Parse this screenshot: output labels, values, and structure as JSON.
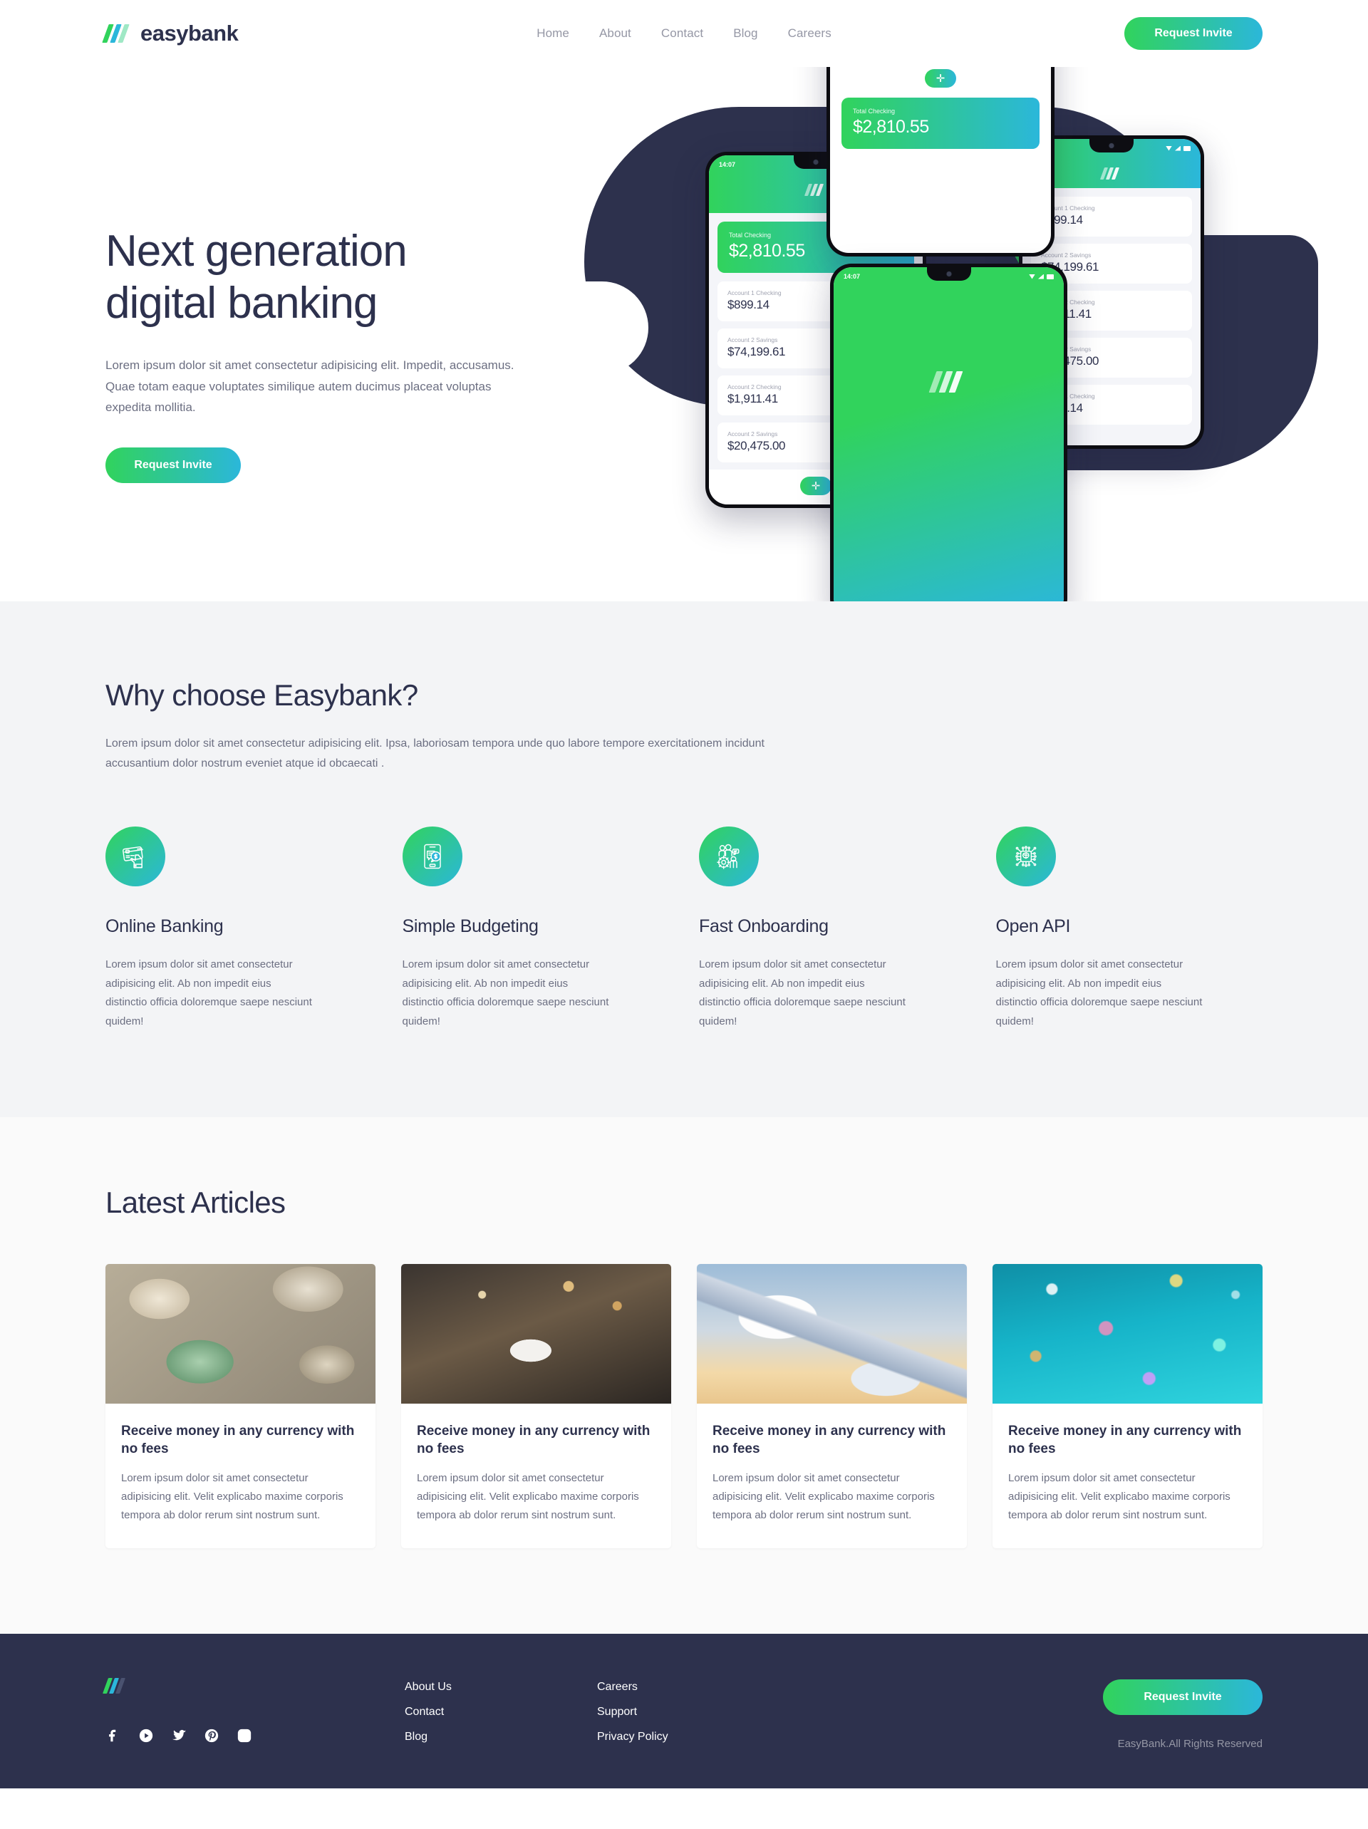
{
  "brand": {
    "name": "easybank",
    "logo_icon": "easybank-stripes-logo"
  },
  "nav": {
    "items": [
      {
        "label": "Home"
      },
      {
        "label": "About"
      },
      {
        "label": "Contact"
      },
      {
        "label": "Blog"
      },
      {
        "label": "Careers"
      }
    ],
    "cta_label": "Request Invite"
  },
  "hero": {
    "title": "Next generation\ndigital banking",
    "subtitle": "Lorem ipsum dolor sit amet consectetur adipisicing elit. Impedit, accusamus. Quae totam eaque voluptates similique autem ducimus placeat voluptas expedita mollitia.",
    "cta_label": "Request Invite",
    "phone_mock": {
      "status_time": "14:07",
      "total_label": "Total Checking",
      "total_amount": "$2,810.55",
      "accounts": [
        {
          "label": "Account 1 Checking",
          "amount": "$899.14"
        },
        {
          "label": "Account 2 Savings",
          "amount": "$74,199.61"
        },
        {
          "label": "Account 2 Checking",
          "amount": "$1,911.41"
        },
        {
          "label": "Account 2 Savings",
          "amount": "$20,475.00"
        },
        {
          "label": "Account 1 Checking",
          "amount": "$899.14"
        }
      ],
      "fab_label": "✛"
    }
  },
  "why": {
    "title": "Why choose Easybank?",
    "subtitle": "Lorem ipsum dolor sit amet consectetur adipisicing elit. Ipsa, laboriosam tempora unde quo labore tempore exercitationem incidunt accusantium dolor nostrum eveniet atque id obcaecati .",
    "features": [
      {
        "icon": "credit-card-hand-icon",
        "title": "Online Banking",
        "text": "Lorem ipsum dolor sit amet consectetur adipisicing elit. Ab non impedit eius distinctio officia doloremque saepe nesciunt quidem!"
      },
      {
        "icon": "phone-money-chat-icon",
        "title": "Simple Budgeting",
        "text": "Lorem ipsum dolor sit amet consectetur adipisicing elit. Ab non impedit eius distinctio officia doloremque saepe nesciunt quidem!"
      },
      {
        "icon": "team-onboarding-icon",
        "title": "Fast Onboarding",
        "text": "Lorem ipsum dolor sit amet consectetur adipisicing elit. Ab non impedit eius distinctio officia doloremque saepe nesciunt quidem!"
      },
      {
        "icon": "api-chip-icon",
        "title": "Open API",
        "text": "Lorem ipsum dolor sit amet consectetur adipisicing elit. Ab non impedit eius distinctio officia doloremque saepe nesciunt quidem!"
      }
    ]
  },
  "articles": {
    "title": "Latest Articles",
    "items": [
      {
        "image": "currency-banknotes-photo",
        "title": "Receive money in any currency with no fees",
        "text": "Lorem ipsum dolor sit amet consectetur adipisicing elit. Velit explicabo maxime corporis tempora ab dolor rerum sint nostrum sunt."
      },
      {
        "image": "restaurant-dining-photo",
        "title": "Receive money in any currency with no fees",
        "text": "Lorem ipsum dolor sit amet consectetur adipisicing elit. Velit explicabo maxime corporis tempora ab dolor rerum sint nostrum sunt."
      },
      {
        "image": "airplane-wing-clouds-photo",
        "title": "Receive money in any currency with no fees",
        "text": "Lorem ipsum dolor sit amet consectetur adipisicing elit. Velit explicabo maxime corporis tempora ab dolor rerum sint nostrum sunt."
      },
      {
        "image": "bokeh-lights-photo",
        "title": "Receive money in any currency with no fees",
        "text": "Lorem ipsum dolor sit amet consectetur adipisicing elit. Velit explicabo maxime corporis tempora ab dolor rerum sint nostrum sunt."
      }
    ]
  },
  "footer": {
    "logo_icon": "easybank-stripes-logo",
    "socials": [
      {
        "icon": "facebook-icon"
      },
      {
        "icon": "youtube-icon"
      },
      {
        "icon": "twitter-icon"
      },
      {
        "icon": "pinterest-icon"
      },
      {
        "icon": "instagram-icon"
      }
    ],
    "links_col1": [
      {
        "label": "About Us"
      },
      {
        "label": "Contact"
      },
      {
        "label": "Blog"
      }
    ],
    "links_col2": [
      {
        "label": "Careers"
      },
      {
        "label": "Support"
      },
      {
        "label": "Privacy Policy"
      }
    ],
    "cta_label": "Request Invite",
    "copyright": "EasyBank.All Rights Reserved"
  },
  "colors": {
    "accent_green": "#31d35c",
    "accent_cyan": "#2bb7da",
    "dark_blue": "#2d314d",
    "grayish_blue": "#9597a5",
    "light_gray_bg": "#f3f4f6",
    "very_light_gray_bg": "#fafafa"
  }
}
